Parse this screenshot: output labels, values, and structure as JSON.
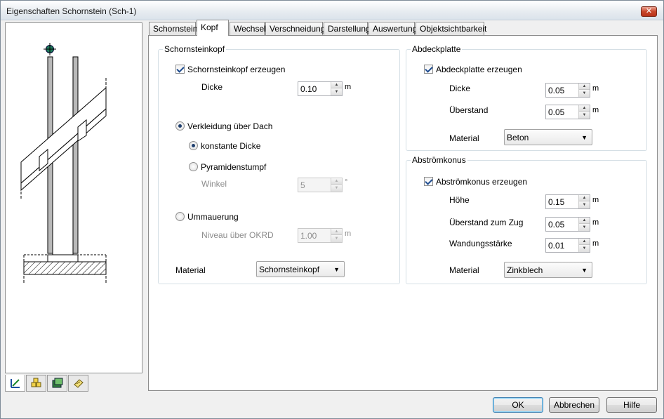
{
  "window": {
    "title": "Eigenschaften Schornstein (Sch-1)",
    "close_glyph": "✕"
  },
  "tabs": [
    {
      "label": "Schornstein"
    },
    {
      "label": "Kopf"
    },
    {
      "label": "Wechsel"
    },
    {
      "label": "Verschneidung"
    },
    {
      "label": "Darstellung"
    },
    {
      "label": "Auswertung"
    },
    {
      "label": "Objektsichtbarkeit"
    }
  ],
  "active_tab": "Kopf",
  "view_tabs": [
    {
      "icon": "drawing-icon"
    },
    {
      "icon": "blocks-icon"
    },
    {
      "icon": "3d-view-icon"
    },
    {
      "icon": "material-icon"
    }
  ],
  "schornsteinkopf": {
    "legend": "Schornsteinkopf",
    "create_label": "Schornsteinkopf erzeugen",
    "create_checked": true,
    "dicke_label": "Dicke",
    "dicke_value": "0.10",
    "dicke_unit": "m",
    "verkleidung_label": "Verkleidung über Dach",
    "verkleidung_selected": true,
    "konstante_label": "konstante Dicke",
    "konstante_selected": true,
    "pyramide_label": "Pyramidenstumpf",
    "winkel_label": "Winkel",
    "winkel_value": "5",
    "winkel_unit": "°",
    "ummauerung_label": "Ummauerung",
    "niveau_label": "Niveau über OKRD",
    "niveau_value": "1.00",
    "niveau_unit": "m",
    "material_label": "Material",
    "material_value": "Schornsteinkopf"
  },
  "abdeckplatte": {
    "legend": "Abdeckplatte",
    "create_label": "Abdeckplatte erzeugen",
    "create_checked": true,
    "dicke_label": "Dicke",
    "dicke_value": "0.05",
    "dicke_unit": "m",
    "ueberstand_label": "Überstand",
    "ueberstand_value": "0.05",
    "ueberstand_unit": "m",
    "material_label": "Material",
    "material_value": "Beton"
  },
  "abstroemkonus": {
    "legend": "Abströmkonus",
    "create_label": "Abströmkonus erzeugen",
    "create_checked": true,
    "hoehe_label": "Höhe",
    "hoehe_value": "0.15",
    "hoehe_unit": "m",
    "ueberstand_label": "Überstand zum Zug",
    "ueberstand_value": "0.05",
    "ueberstand_unit": "m",
    "wandung_label": "Wandungsstärke",
    "wandung_value": "0.01",
    "wandung_unit": "m",
    "material_label": "Material",
    "material_value": "Zinkblech"
  },
  "buttons": {
    "ok": "OK",
    "cancel": "Abbrechen",
    "help": "Hilfe"
  },
  "spin_arrows": {
    "up": "▲",
    "down": "▼"
  },
  "combo_arrow": "▼"
}
